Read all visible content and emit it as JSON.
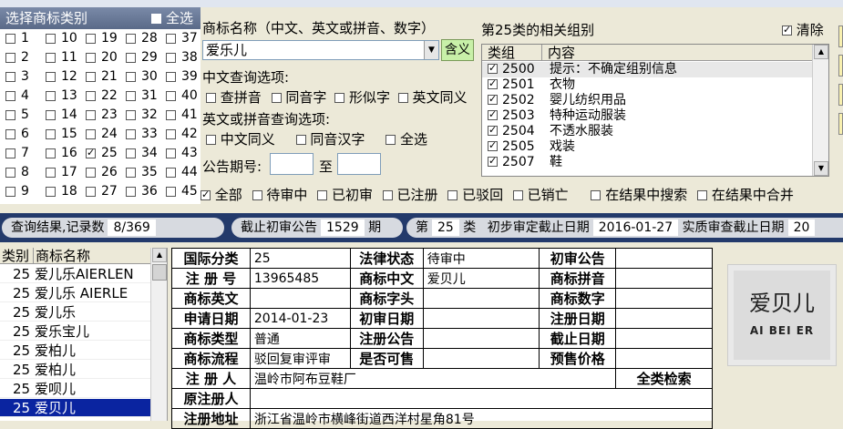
{
  "left_panel": {
    "title": "选择商标类别",
    "select_all": "全选",
    "classes": [
      "1",
      "2",
      "3",
      "4",
      "5",
      "6",
      "7",
      "8",
      "9",
      "10",
      "11",
      "12",
      "13",
      "14",
      "15",
      "16",
      "17",
      "18",
      "19",
      "20",
      "21",
      "22",
      "23",
      "24",
      "25",
      "26",
      "27",
      "28",
      "29",
      "30",
      "31",
      "32",
      "33",
      "34",
      "35",
      "36",
      "37",
      "38",
      "39",
      "40",
      "41",
      "42",
      "43",
      "44",
      "45"
    ],
    "checked_class": "25"
  },
  "search": {
    "name_label": "商标名称（中文、英文或拼音、数字）",
    "name_value": "爱乐儿",
    "hanyi_button": "含义",
    "cn_options_label": "中文查询选项:",
    "cn_options": [
      "查拼音",
      "同音字",
      "形似字",
      "英文同义"
    ],
    "en_options_label": "英文或拼音查询选项:",
    "en_options": [
      "中文同义",
      "同音汉字",
      "全选"
    ],
    "period_label": "公告期号:",
    "to_label": "至"
  },
  "groups": {
    "title": "第25类的相关组别",
    "clear_label": "清除",
    "col_group": "类组",
    "col_content": "内容",
    "rows": [
      {
        "code": "2500",
        "text": "提示：不确定组别信息"
      },
      {
        "code": "2501",
        "text": "衣物"
      },
      {
        "code": "2502",
        "text": "婴儿纺织用品"
      },
      {
        "code": "2503",
        "text": "特种运动服装"
      },
      {
        "code": "2504",
        "text": "不透水服装"
      },
      {
        "code": "2505",
        "text": "戏装"
      },
      {
        "code": "2507",
        "text": "鞋"
      }
    ]
  },
  "filters": {
    "items": [
      "全部",
      "待审中",
      "已初审",
      "已注册",
      "已驳回",
      "已销亡"
    ],
    "search_in_results": "在结果中搜索",
    "merge_in_results": "在结果中合并"
  },
  "status": {
    "result_label": "查询结果,记录数",
    "result_value": "8/369",
    "deadline_label": "截止初审公告",
    "deadline_value": "1529",
    "period_unit": "期",
    "class_prefix": "第",
    "class_value": "25",
    "class_suffix": "类",
    "prelim_label": "初步审定截止日期",
    "prelim_value": "2016-01-27",
    "actual_label": "实质审查截止日期",
    "actual_value": "20"
  },
  "results": {
    "col_class": "类别",
    "col_name": "商标名称",
    "rows": [
      {
        "cls": "25",
        "name": "爱儿乐AIERLEN"
      },
      {
        "cls": "25",
        "name": "爱儿乐 AIERLE"
      },
      {
        "cls": "25",
        "name": "爱儿乐"
      },
      {
        "cls": "25",
        "name": "爱乐宝儿"
      },
      {
        "cls": "25",
        "name": "爱柏儿"
      },
      {
        "cls": "25",
        "name": "爱柏儿"
      },
      {
        "cls": "25",
        "name": "爱呗儿"
      },
      {
        "cls": "25",
        "name": "爱贝儿"
      }
    ],
    "selected_index": 7
  },
  "detail": {
    "intl_class_label": "国际分类",
    "intl_class": "25",
    "legal_status_label": "法律状态",
    "legal_status": "待审中",
    "prelim_pub_label": "初审公告",
    "reg_no_label": "注 册 号",
    "reg_no": "13965485",
    "cn_name_label": "商标中文",
    "cn_name": "爱贝儿",
    "pinyin_label": "商标拼音",
    "en_name_label": "商标英文",
    "initials_label": "商标字头",
    "digits_label": "商标数字",
    "apply_date_label": "申请日期",
    "apply_date": "2014-01-23",
    "prelim_date_label": "初审日期",
    "reg_date_label": "注册日期",
    "type_label": "商标类型",
    "type": "普通",
    "reg_pub_label": "注册公告",
    "expiry_label": "截止日期",
    "flow_label": "商标流程",
    "flow": "驳回复审评审",
    "for_sale_label": "是否可售",
    "price_label": "预售价格",
    "registrant_label": "注 册 人",
    "registrant": "温岭市阿布豆鞋厂",
    "all_search": "全类检索",
    "orig_registrant_label": "原注册人",
    "address_label": "注册地址",
    "address": "浙江省温岭市横峰街道西洋村星角81号"
  },
  "image": {
    "mark_text": "爱贝儿 AI BEI ER"
  }
}
